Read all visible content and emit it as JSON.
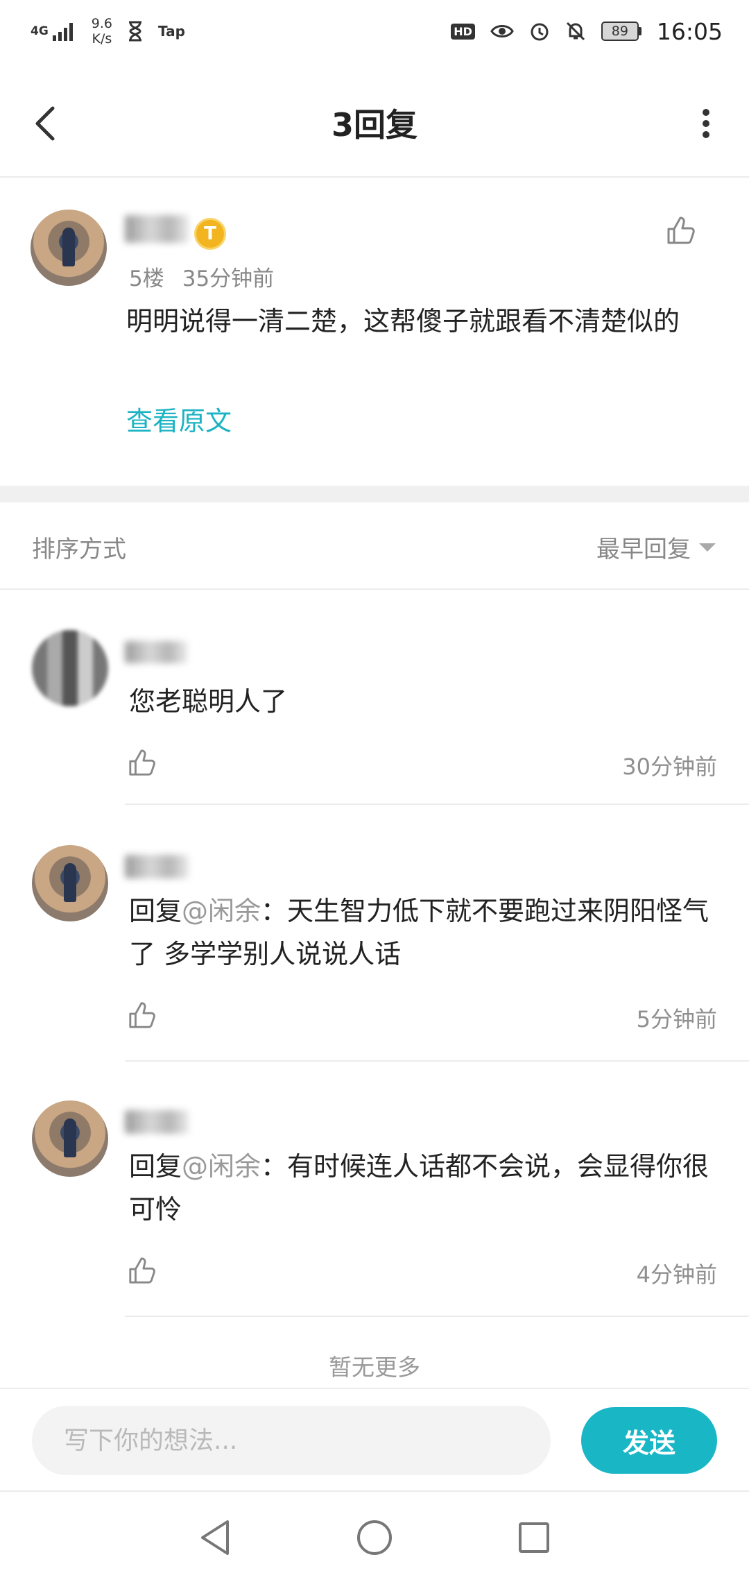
{
  "status_bar": {
    "network": "4G",
    "speed_value": "9.6",
    "speed_unit": "K/s",
    "app_indicator": "Tap",
    "hd_label": "HD",
    "battery_level": "89",
    "time": "16:05",
    "icons": [
      "signal-icon",
      "hourglass-icon",
      "eye-icon",
      "alarm-icon",
      "mute-bell-icon",
      "battery-icon"
    ]
  },
  "header": {
    "title": "3回复",
    "back_icon": "back-arrow-icon",
    "more_icon": "more-vertical-icon"
  },
  "main_post": {
    "level_badge": "T",
    "floor": "5楼",
    "time": "35分钟前",
    "content": "明明说得一清二楚，这帮傻子就跟看不清楚似的",
    "view_original": "查看原文"
  },
  "sort": {
    "label": "排序方式",
    "value": "最早回复"
  },
  "replies": [
    {
      "prefix": "",
      "mention": "",
      "text": "您老聪明人了",
      "time": "30分钟前"
    },
    {
      "prefix": "回复",
      "mention": "@闲余",
      "text": "：天生智力低下就不要跑过来阴阳怪气了 多学学别人说说人话",
      "time": "5分钟前"
    },
    {
      "prefix": "回复",
      "mention": "@闲余",
      "text": "：有时候连人话都不会说，会显得你很可怜",
      "time": "4分钟前"
    }
  ],
  "no_more": "暂无更多",
  "input": {
    "placeholder": "写下你的想法...",
    "send_label": "发送"
  },
  "colors": {
    "accent": "#19b6c6",
    "link": "#1bb3c3",
    "badge": "#f2b520"
  }
}
